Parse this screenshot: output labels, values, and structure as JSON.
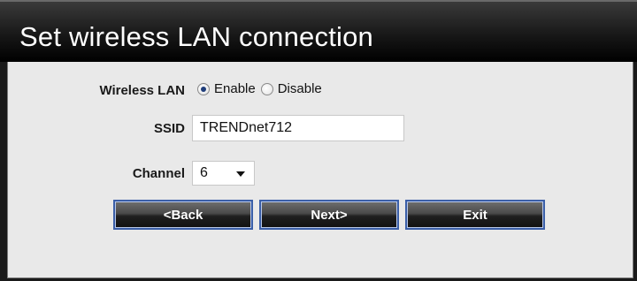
{
  "title": "Set wireless LAN connection",
  "wireless_lan": {
    "label": "Wireless LAN",
    "options": [
      "Enable",
      "Disable"
    ],
    "selected": "Enable"
  },
  "ssid": {
    "label": "SSID",
    "value": "TRENDnet712"
  },
  "channel": {
    "label": "Channel",
    "value": "6"
  },
  "buttons": {
    "back": "<Back",
    "next": "Next>",
    "exit": "Exit"
  },
  "colors": {
    "title_bar": "#000000",
    "panel_bg": "#e9e9e9",
    "button_border": "#3b5fa8"
  }
}
